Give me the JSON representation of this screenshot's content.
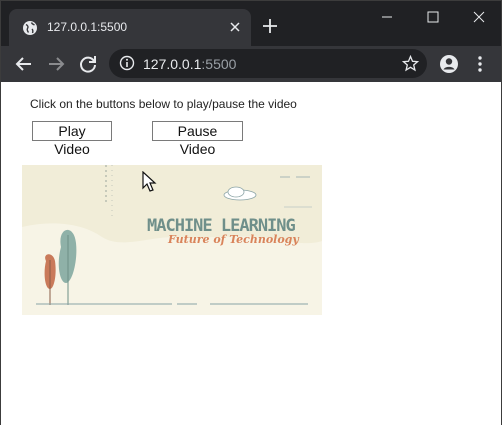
{
  "browser": {
    "tab_title": "127.0.0.1:5500",
    "url_host": "127.0.0.1",
    "url_port": ":5500",
    "icons": {
      "favicon": "globe-icon",
      "close": "close-icon",
      "new_tab": "plus-icon",
      "back": "back-arrow-icon",
      "forward": "forward-arrow-icon",
      "reload": "reload-icon",
      "info": "info-icon",
      "bookmark": "star-icon",
      "profile": "profile-icon",
      "menu": "kebab-menu-icon"
    }
  },
  "page": {
    "instructions": "Click on the buttons below to play/pause the video",
    "play_label": "Play Video",
    "pause_label": "Pause Video"
  },
  "video": {
    "title": "MACHINE LEARNING",
    "subtitle": "Future of Technology",
    "title_color": "#6f8f8a",
    "subtitle_color": "#d9835a",
    "background": "#f1edd8"
  }
}
